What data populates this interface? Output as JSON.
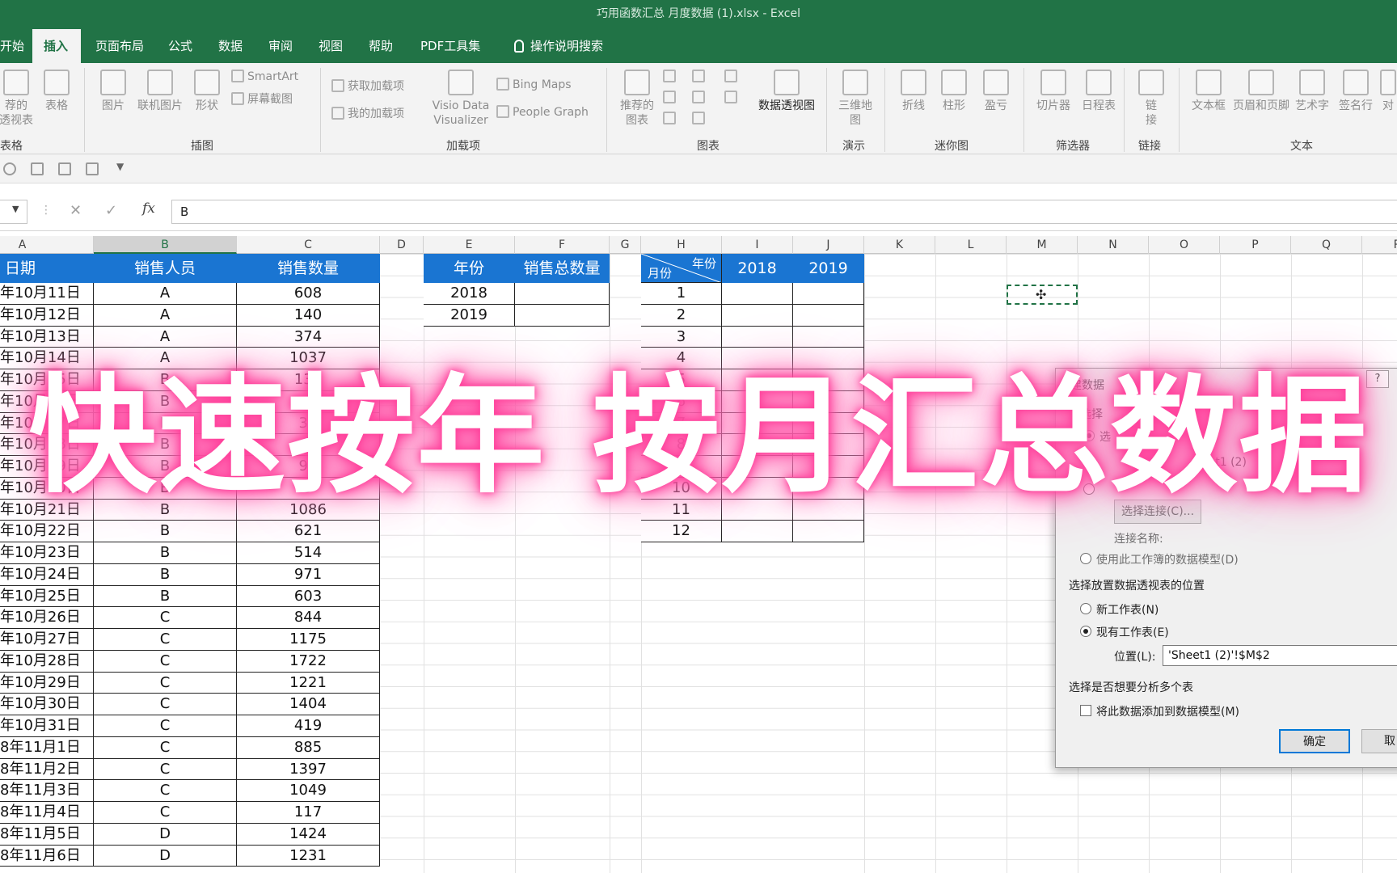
{
  "title_bar": {
    "text": "巧用函数汇总 月度数据 (1).xlsx  -  Excel"
  },
  "tabs": [
    "开始",
    "插入",
    "页面布局",
    "公式",
    "数据",
    "审阅",
    "视图",
    "帮助",
    "PDF工具集"
  ],
  "tell_me": "操作说明搜索",
  "ribbon": {
    "tables": {
      "recommended_pivot": [
        "荐的",
        "透视表"
      ],
      "table": "表格",
      "group": "表格"
    },
    "illustrations": {
      "pictures": "图片",
      "online_pictures": "联机图片",
      "shapes": "形状",
      "smartart": "SmartArt",
      "screenshot": "屏幕截图",
      "group": "插图"
    },
    "addins": {
      "get_addins": "获取加载项",
      "my_addins": "我的加载项",
      "visio": [
        "Visio Data",
        "Visualizer"
      ],
      "bing_maps": "Bing Maps",
      "people_graph": "People Graph",
      "group": "加载项"
    },
    "charts": {
      "recommended": [
        "推荐的",
        "图表"
      ],
      "pivot_chart": "数据透视图",
      "group": "图表"
    },
    "tours": {
      "map3d": [
        "三维地",
        "图"
      ],
      "group": "演示"
    },
    "sparklines": {
      "line": "折线",
      "column": "柱形",
      "winloss": "盈亏",
      "group": "迷你图"
    },
    "filters": {
      "slicer": "切片器",
      "timeline": "日程表",
      "group": "筛选器"
    },
    "links": {
      "link": [
        "链",
        "接"
      ],
      "group": "链接"
    },
    "text": {
      "textbox": "文本框",
      "header_footer": "页眉和页脚",
      "wordart": "艺术字",
      "signature": "签名行",
      "object": "对",
      "group": "文本"
    }
  },
  "formula_bar": {
    "cancel": "✕",
    "enter": "✓",
    "fx": "fx",
    "content": "B"
  },
  "columns": [
    "A",
    "B",
    "C",
    "D",
    "E",
    "F",
    "G",
    "H",
    "I",
    "J",
    "K",
    "L",
    "M",
    "N",
    "O",
    "P",
    "Q",
    "R"
  ],
  "table1": {
    "headers": [
      "日期",
      "销售人员",
      "销售数量"
    ],
    "rows": [
      [
        "年10月11日",
        "A",
        "608"
      ],
      [
        "年10月12日",
        "A",
        "140"
      ],
      [
        "年10月13日",
        "A",
        "374"
      ],
      [
        "年10月14日",
        "A",
        "1037"
      ],
      [
        "年10月15日",
        "B",
        "139"
      ],
      [
        "年10月16日",
        "B",
        ""
      ],
      [
        "年10月17日",
        "B",
        "36"
      ],
      [
        "年10月18日",
        "B",
        "1"
      ],
      [
        "年10月19日",
        "B",
        "95"
      ],
      [
        "年10月20日",
        "B",
        "5"
      ],
      [
        "年10月21日",
        "B",
        "1086"
      ],
      [
        "年10月22日",
        "B",
        "621"
      ],
      [
        "年10月23日",
        "B",
        "514"
      ],
      [
        "年10月24日",
        "B",
        "971"
      ],
      [
        "年10月25日",
        "B",
        "603"
      ],
      [
        "年10月26日",
        "C",
        "844"
      ],
      [
        "年10月27日",
        "C",
        "1175"
      ],
      [
        "年10月28日",
        "C",
        "1722"
      ],
      [
        "年10月29日",
        "C",
        "1221"
      ],
      [
        "年10月30日",
        "C",
        "1404"
      ],
      [
        "年10月31日",
        "C",
        "419"
      ],
      [
        "8年11月1日",
        "C",
        "885"
      ],
      [
        "8年11月2日",
        "C",
        "1397"
      ],
      [
        "8年11月3日",
        "C",
        "1049"
      ],
      [
        "8年11月4日",
        "C",
        "117"
      ],
      [
        "8年11月5日",
        "D",
        "1424"
      ],
      [
        "8年11月6日",
        "D",
        "1231"
      ]
    ]
  },
  "table2": {
    "headers": [
      "年份",
      "销售总数量"
    ],
    "rows": [
      [
        "2018",
        ""
      ],
      [
        "2019",
        ""
      ]
    ]
  },
  "table3": {
    "corner_top": "年份",
    "corner_bottom": "月份",
    "years": [
      "2018",
      "2019"
    ],
    "months": [
      "1",
      "2",
      "3",
      "4",
      "5",
      "6",
      "7",
      "8",
      "9",
      "10",
      "11",
      "12"
    ]
  },
  "dialog": {
    "title": "建数据",
    "help": "?",
    "select_label": "选择",
    "radio_select": "选",
    "range_value": "eet1 (2)",
    "choose_conn_btn": "选择连接(C)...",
    "conn_name_label": "连接名称:",
    "use_model": "使用此工作簿的数据模型(D)",
    "place_label": "选择放置数据透视表的位置",
    "new_sheet": "新工作表(N)",
    "existing_sheet": "现有工作表(E)",
    "location_label": "位置(L):",
    "location_value": "'Sheet1 (2)'!$M$2",
    "multi_label": "选择是否想要分析多个表",
    "add_model": "将此数据添加到数据模型(M)",
    "ok": "确定",
    "cancel": "取"
  },
  "overlay_text": "快速按年 按月汇总数据"
}
